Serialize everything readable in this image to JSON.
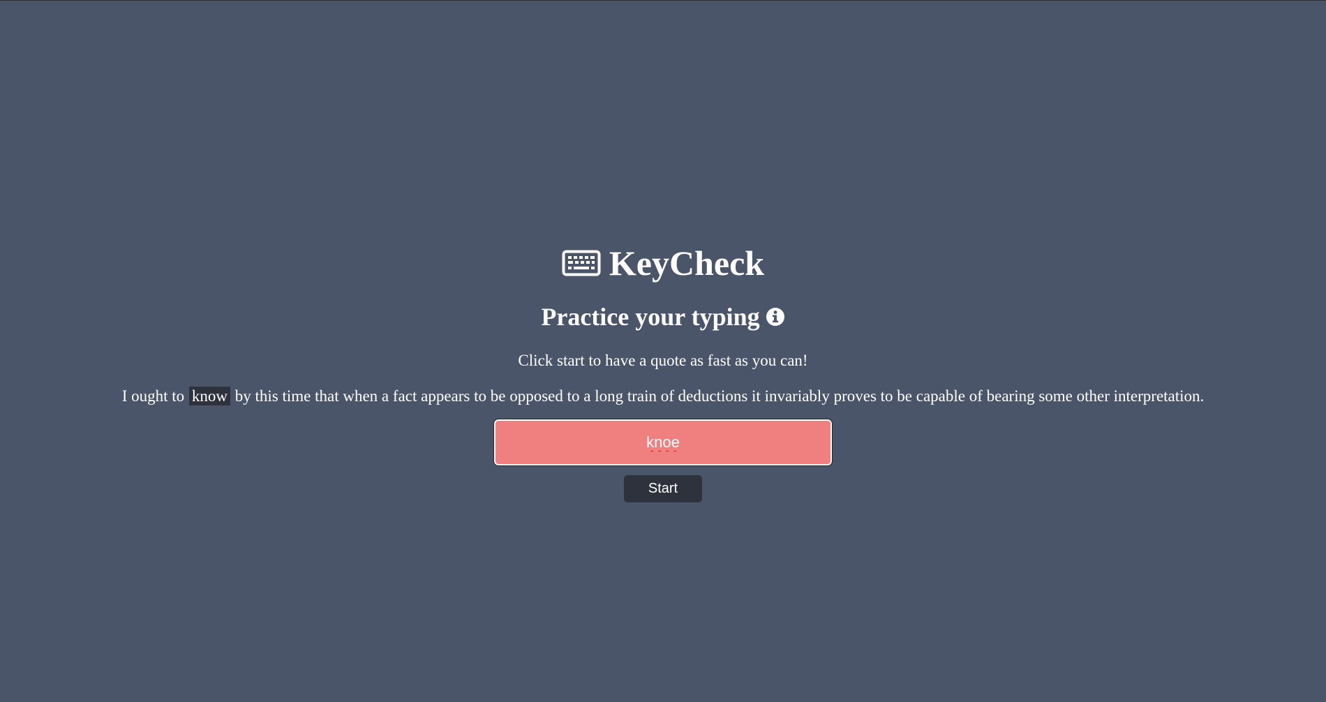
{
  "app": {
    "title": "KeyCheck",
    "icon": "keyboard-icon"
  },
  "header": {
    "subtitle": "Practice your typing",
    "info_icon": "info-icon"
  },
  "instructions": "Click start to have a quote as fast as you can!",
  "quote": {
    "before": "I ought to",
    "current_word": "know",
    "after": "by this time that when a fact appears to be opposed to a long train of deductions it invariably proves to be capable of bearing some other interpretation."
  },
  "input": {
    "value": "knoe",
    "state": "error"
  },
  "controls": {
    "start_label": "Start"
  },
  "colors": {
    "background": "#4b5569",
    "input_error": "#f08080",
    "dark_accent": "#2d323c",
    "text": "#ffffff"
  }
}
